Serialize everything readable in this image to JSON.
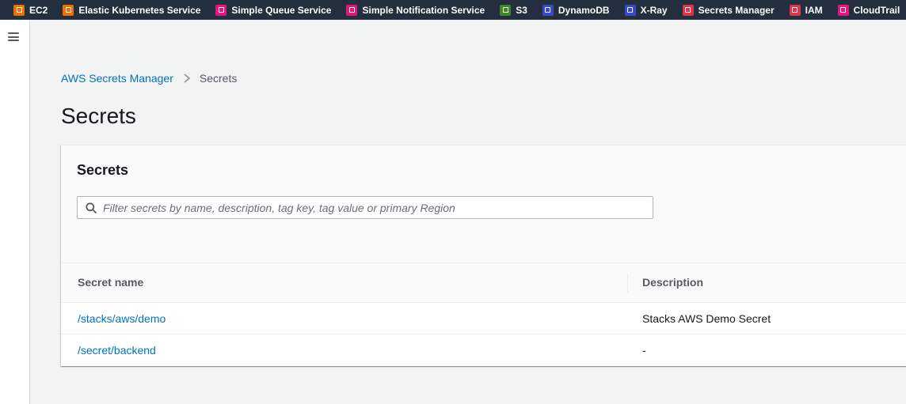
{
  "favorites": [
    {
      "label": "EC2",
      "icon": "ec2-icon",
      "color": "#ed7100"
    },
    {
      "label": "Elastic Kubernetes Service",
      "icon": "eks-icon",
      "color": "#ed7100"
    },
    {
      "label": "Simple Queue Service",
      "icon": "sqs-icon",
      "color": "#e7157b"
    },
    {
      "label": "Simple Notification Service",
      "icon": "sns-icon",
      "color": "#e7157b"
    },
    {
      "label": "S3",
      "icon": "s3-icon",
      "color": "#3f8624"
    },
    {
      "label": "DynamoDB",
      "icon": "dynamodb-icon",
      "color": "#3b48cc"
    },
    {
      "label": "X-Ray",
      "icon": "xray-icon",
      "color": "#3b48cc"
    },
    {
      "label": "Secrets Manager",
      "icon": "secrets-manager-icon",
      "color": "#dd344c"
    },
    {
      "label": "IAM",
      "icon": "iam-icon",
      "color": "#dd344c"
    },
    {
      "label": "CloudTrail",
      "icon": "cloudtrail-icon",
      "color": "#e7157b"
    }
  ],
  "breadcrumb": {
    "root": "AWS Secrets Manager",
    "current": "Secrets"
  },
  "page": {
    "title": "Secrets"
  },
  "panel": {
    "title": "Secrets",
    "search_placeholder": "Filter secrets by name, description, tag key, tag value or primary Region"
  },
  "table": {
    "columns": [
      "Secret name",
      "Description"
    ],
    "rows": [
      {
        "name": "/stacks/aws/demo",
        "description": "Stacks AWS Demo Secret"
      },
      {
        "name": "/secret/backend",
        "description": "-"
      }
    ]
  },
  "colors": {
    "topbar": "#232f3e",
    "link": "#0073bb",
    "background": "#f2f3f3"
  }
}
